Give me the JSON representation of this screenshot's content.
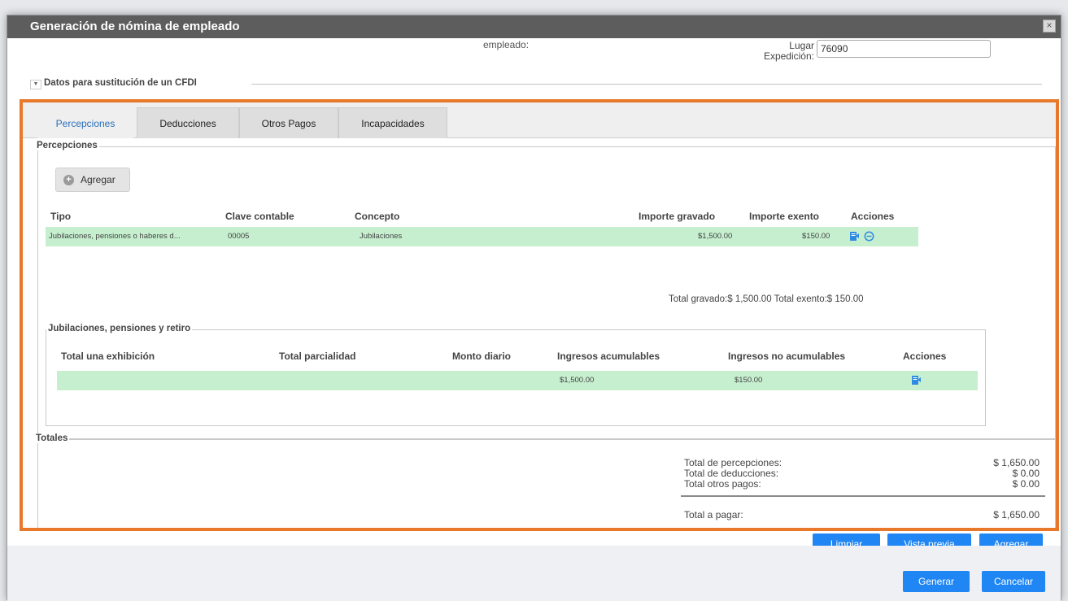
{
  "dialog": {
    "title": "Generación de nómina de empleado",
    "close_glyph": "×"
  },
  "header": {
    "empleado_label": "empleado:",
    "lugar_label": "Lugar Expedición:",
    "lugar_value": "76090"
  },
  "cfdi": {
    "legend": "Datos para sustitución de un CFDI"
  },
  "tabs": [
    {
      "label": "Percepciones"
    },
    {
      "label": "Deducciones"
    },
    {
      "label": "Otros Pagos"
    },
    {
      "label": "Incapacidades"
    }
  ],
  "percepciones": {
    "legend": "Percepciones",
    "add_label": "Agregar",
    "headers": {
      "tipo": "Tipo",
      "clave": "Clave contable",
      "concepto": "Concepto",
      "gravado": "Importe gravado",
      "exento": "Importe exento",
      "acciones": "Acciones"
    },
    "rows": [
      {
        "tipo": "Jubilaciones, pensiones o haberes d...",
        "clave": "00005",
        "concepto": "Jubilaciones",
        "gravado": "$1,500.00",
        "exento": "$150.00"
      }
    ],
    "totals": "Total gravado:$ 1,500.00  Total exento:$ 150.00"
  },
  "jubilaciones": {
    "legend": "Jubilaciones, pensiones y retiro",
    "headers": {
      "exhibicion": "Total una exhibición",
      "parcialidad": "Total parcialidad",
      "diario": "Monto diario",
      "acumulables": "Ingresos acumulables",
      "no_acumulables": "Ingresos no acumulables",
      "acciones": "Acciones"
    },
    "rows": [
      {
        "acumulables": "$1,500.00",
        "no_acumulables": "$150.00"
      }
    ]
  },
  "totales": {
    "legend": "Totales",
    "percepciones_label": "Total de percepciones:",
    "percepciones_value": "$ 1,650.00",
    "deducciones_label": "Total de deducciones:",
    "deducciones_value": "$ 0.00",
    "otros_label": "Total otros pagos:",
    "otros_value": "$ 0.00",
    "pagar_label": "Total a pagar:",
    "pagar_value": "$ 1,650.00"
  },
  "buttons": {
    "limpiar": "Limpiar",
    "vista_previa": "Vista previa",
    "agregar": "Agregar",
    "generar": "Generar",
    "cancelar": "Cancelar"
  },
  "colors": {
    "accent": "#1f86f3",
    "highlight_border": "#e8782a",
    "row_green": "#c6efcf",
    "active_tab_text": "#2a6fb8"
  }
}
